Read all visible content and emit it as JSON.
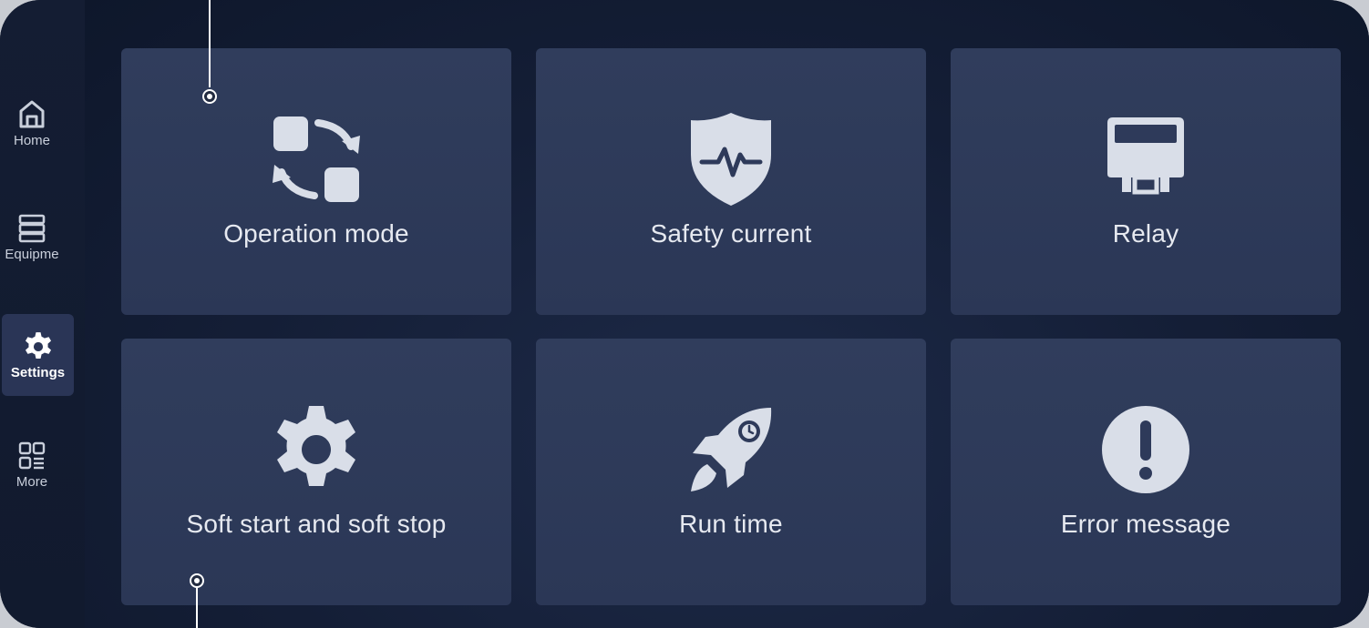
{
  "sidebar": {
    "items": [
      {
        "label": "Home",
        "icon": "home-icon",
        "active": false
      },
      {
        "label": "Equipme",
        "icon": "equipment-list-icon",
        "active": false
      },
      {
        "label": "Settings",
        "icon": "settings-gear-icon",
        "active": true
      },
      {
        "label": "More",
        "icon": "grid-more-icon",
        "active": false
      }
    ]
  },
  "cards": [
    {
      "label": "Operation mode",
      "icon": "mode-switch-icon"
    },
    {
      "label": "Safety current",
      "icon": "shield-pulse-icon"
    },
    {
      "label": "Relay",
      "icon": "relay-icon"
    },
    {
      "label": "Soft start and soft stop",
      "icon": "gear-icon"
    },
    {
      "label": "Run time",
      "icon": "rocket-clock-icon"
    },
    {
      "label": "Error message",
      "icon": "exclamation-circle-icon"
    }
  ],
  "colors": {
    "background": "#0b1326",
    "sidebar": "#141d33",
    "card": "#2e3a5a",
    "icon": "#d9dee8",
    "text": "#e6e9f0",
    "active_nav": "#2a3556"
  }
}
